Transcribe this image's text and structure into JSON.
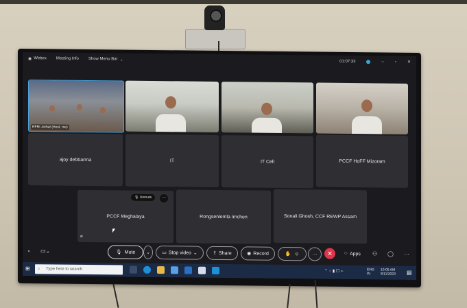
{
  "app": {
    "name": "Webex",
    "meeting_info": "Meeting Info",
    "menu_bar": "Show Menu Bar",
    "timer": "01:07:33"
  },
  "video_tiles": [
    {
      "label": "RFRI Jorhat (Host, me)"
    },
    {
      "label": ""
    },
    {
      "label": ""
    },
    {
      "label": ""
    }
  ],
  "name_tiles_row1": [
    "ajoy debbarma",
    "IT",
    "IT Cell",
    "PCCF HoFF Mizoram"
  ],
  "name_tiles_row2": [
    "PCCF Meghalaya",
    "Rongsenlemla Imchen",
    "Sonali Ghosh, CCF REWP Assam"
  ],
  "unmute_chip": "Unmute",
  "controls": {
    "mute": "Mute",
    "stop_video": "Stop video",
    "share": "Share",
    "record": "Record",
    "apps": "Apps"
  },
  "taskbar": {
    "search_placeholder": "Type here to search",
    "lang_top": "ENG",
    "lang_bottom": "IN",
    "time": "10:05 AM",
    "date": "8/11/2023"
  },
  "colors": {
    "accent_blue": "#4aa3df",
    "end_red": "#e3344a",
    "tile_bg": "#2e2e33"
  }
}
